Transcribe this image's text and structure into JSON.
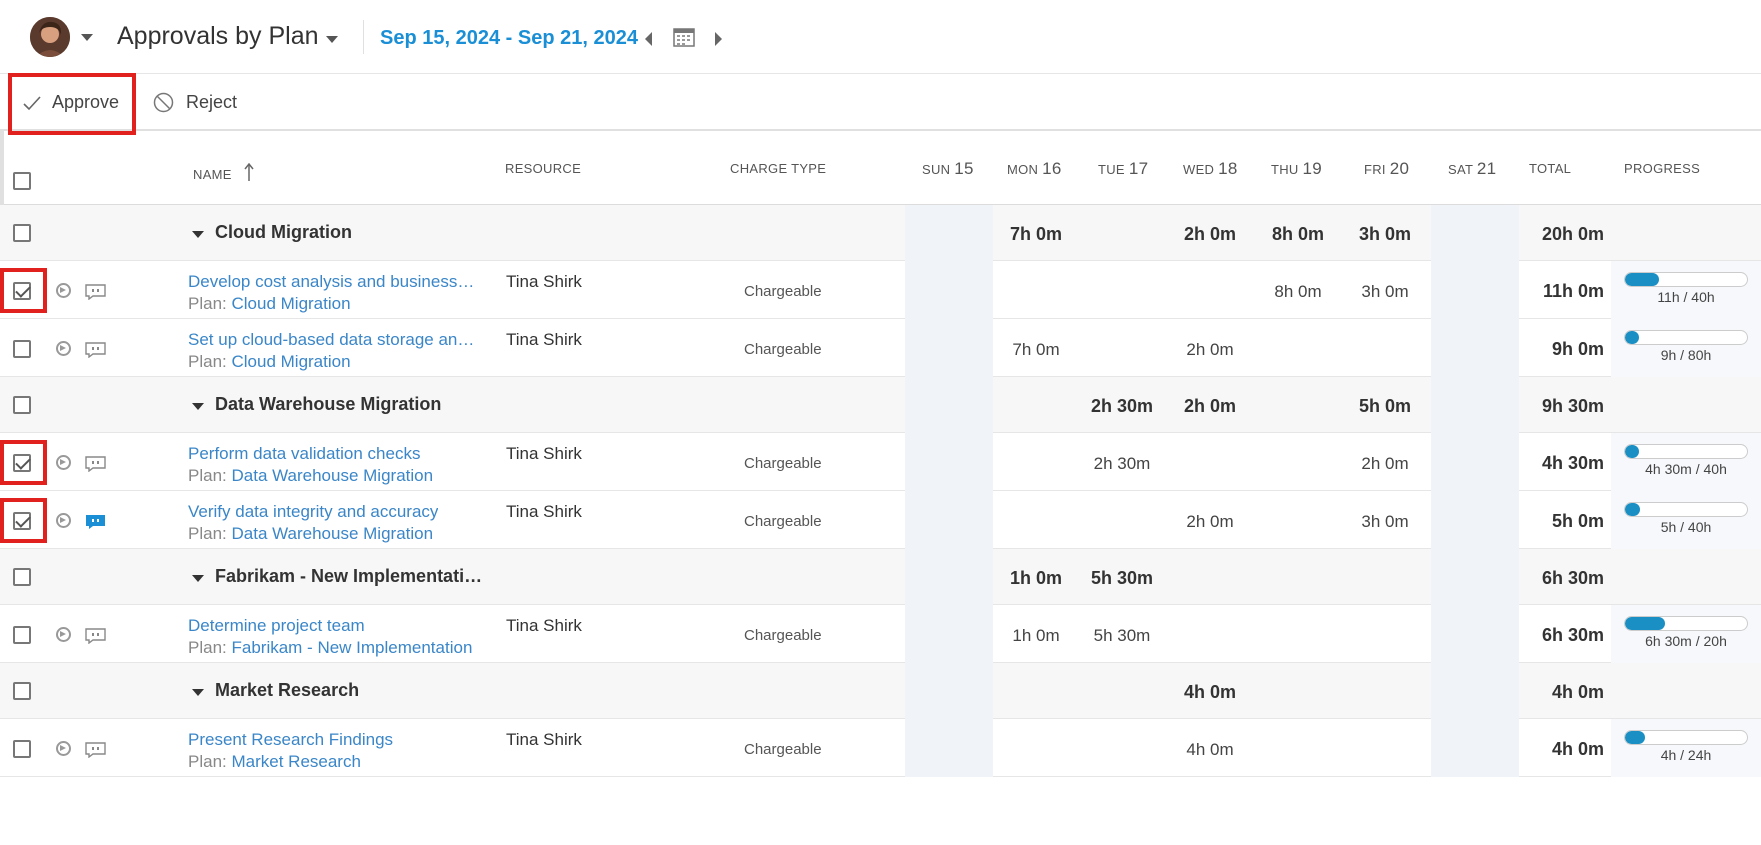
{
  "header": {
    "title": "Approvals by Plan",
    "date_range": "Sep 15, 2024 - Sep 21, 2024"
  },
  "toolbar": {
    "approve_label": "Approve",
    "reject_label": "Reject"
  },
  "columns": {
    "name": "NAME",
    "resource": "RESOURCE",
    "charge_type": "CHARGE TYPE",
    "sun_day": "SUN",
    "sun_num": "15",
    "mon_day": "MON",
    "mon_num": "16",
    "tue_day": "TUE",
    "tue_num": "17",
    "wed_day": "WED",
    "wed_num": "18",
    "thu_day": "THU",
    "thu_num": "19",
    "fri_day": "FRI",
    "fri_num": "20",
    "sat_day": "SAT",
    "sat_num": "21",
    "total": "TOTAL",
    "progress": "PROGRESS"
  },
  "plan_prefix": "Plan:",
  "groups": [
    {
      "name": "Cloud Migration",
      "mon": "7h 0m",
      "wed": "2h 0m",
      "thu": "8h 0m",
      "fri": "3h 0m",
      "total": "20h 0m",
      "tasks": [
        {
          "name": "Develop cost analysis and business …",
          "plan": "Cloud Migration",
          "resource": "Tina Shirk",
          "charge": "Chargeable",
          "thu": "8h 0m",
          "fri": "3h 0m",
          "total": "11h 0m",
          "progress_text": "11h / 40h",
          "progress": 0.275,
          "checked": true
        },
        {
          "name": "Set up cloud-based data storage an…",
          "plan": "Cloud Migration",
          "resource": "Tina Shirk",
          "charge": "Chargeable",
          "mon": "7h 0m",
          "wed": "2h 0m",
          "total": "9h 0m",
          "progress_text": "9h / 80h",
          "progress": 0.1125,
          "checked": false
        }
      ]
    },
    {
      "name": "Data Warehouse Migration",
      "tue": "2h 30m",
      "wed": "2h 0m",
      "fri": "5h 0m",
      "total": "9h 30m",
      "tasks": [
        {
          "name": "Perform data validation checks",
          "plan": "Data Warehouse Migration",
          "resource": "Tina Shirk",
          "charge": "Chargeable",
          "tue": "2h 30m",
          "fri": "2h 0m",
          "total": "4h 30m",
          "progress_text": "4h 30m / 40h",
          "progress": 0.1125,
          "checked": true
        },
        {
          "name": "Verify data integrity and accuracy",
          "plan": "Data Warehouse Migration",
          "resource": "Tina Shirk",
          "charge": "Chargeable",
          "wed": "2h 0m",
          "fri": "3h 0m",
          "total": "5h 0m",
          "progress_text": "5h / 40h",
          "progress": 0.125,
          "checked": true
        }
      ]
    },
    {
      "name": "Fabrikam - New Implementati…",
      "mon": "1h 0m",
      "tue": "5h 30m",
      "total": "6h 30m",
      "tasks": [
        {
          "name": "Determine project team",
          "plan": "Fabrikam - New Implementation",
          "resource": "Tina Shirk",
          "charge": "Chargeable",
          "mon": "1h 0m",
          "tue": "5h 30m",
          "total": "6h 30m",
          "progress_text": "6h 30m / 20h",
          "progress": 0.325,
          "checked": false
        }
      ]
    },
    {
      "name": "Market Research",
      "wed": "4h 0m",
      "total": "4h 0m",
      "tasks": [
        {
          "name": "Present Research Findings",
          "plan": "Market Research",
          "resource": "Tina Shirk",
          "charge": "Chargeable",
          "wed": "4h 0m",
          "total": "4h 0m",
          "progress_text": "4h / 24h",
          "progress": 0.167,
          "checked": false
        }
      ]
    }
  ],
  "colors": {
    "accent": "#1a8fd6",
    "link": "#3a86c8",
    "highlight": "#e0211d",
    "progress": "#1a8fc4"
  }
}
